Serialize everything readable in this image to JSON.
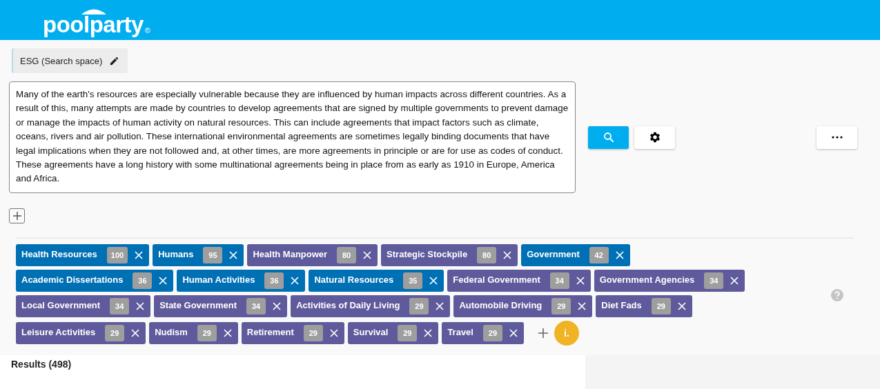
{
  "header": {
    "logo": "poolparty",
    "trademark": "®"
  },
  "search_space": {
    "label": "ESG (Search space)"
  },
  "query": {
    "value": "Many of the earth's resources are especially vulnerable because they are influenced by human impacts across different countries. As a result of this, many attempts are made by countries to develop agreements that are signed by multiple governments to prevent damage or manage the impacts of human activity on natural resources. This can include agreements that impact factors such as climate, oceans, rivers and air pollution. These international environmental agreements are sometimes legally binding documents that have legal implications when they are not followed and, at other times, are more agreements in principle or are for use as codes of conduct. These agreements have a long history with some multinational agreements being in place from as early as 1910 in Europe, America and Africa."
  },
  "tags": [
    {
      "label": "Health Resources",
      "count": "100",
      "color": "#0070b5"
    },
    {
      "label": "Humans",
      "count": "95",
      "color": "#0070b5"
    },
    {
      "label": "Health Manpower",
      "count": "80",
      "color": "#5e5a9c"
    },
    {
      "label": "Strategic Stockpile",
      "count": "80",
      "color": "#5e5a9c"
    },
    {
      "label": "Government",
      "count": "42",
      "color": "#0070b5"
    },
    {
      "label": "Academic Dissertations",
      "count": "36",
      "color": "#0070b5"
    },
    {
      "label": "Human Activities",
      "count": "36",
      "color": "#0070b5"
    },
    {
      "label": "Natural Resources",
      "count": "35",
      "color": "#0070b5"
    },
    {
      "label": "Federal Government",
      "count": "34",
      "color": "#5e5a9c"
    },
    {
      "label": "Government Agencies",
      "count": "34",
      "color": "#5e5a9c"
    },
    {
      "label": "Local Government",
      "count": "34",
      "color": "#5e5a9c"
    },
    {
      "label": "State Government",
      "count": "34",
      "color": "#5e5a9c"
    },
    {
      "label": "Activities of Daily Living",
      "count": "29",
      "color": "#5e5a9c"
    },
    {
      "label": "Automobile Driving",
      "count": "29",
      "color": "#5e5a9c"
    },
    {
      "label": "Diet Fads",
      "count": "29",
      "color": "#5e5a9c"
    },
    {
      "label": "Leisure Activities",
      "count": "29",
      "color": "#5e5a9c"
    },
    {
      "label": "Nudism",
      "count": "29",
      "color": "#5e5a9c"
    },
    {
      "label": "Retirement",
      "count": "29",
      "color": "#5e5a9c"
    },
    {
      "label": "Survival",
      "count": "29",
      "color": "#5e5a9c"
    },
    {
      "label": "Travel",
      "count": "29",
      "color": "#5e5a9c"
    }
  ],
  "info_badge": "i.",
  "results": {
    "title": "Results (498)"
  }
}
